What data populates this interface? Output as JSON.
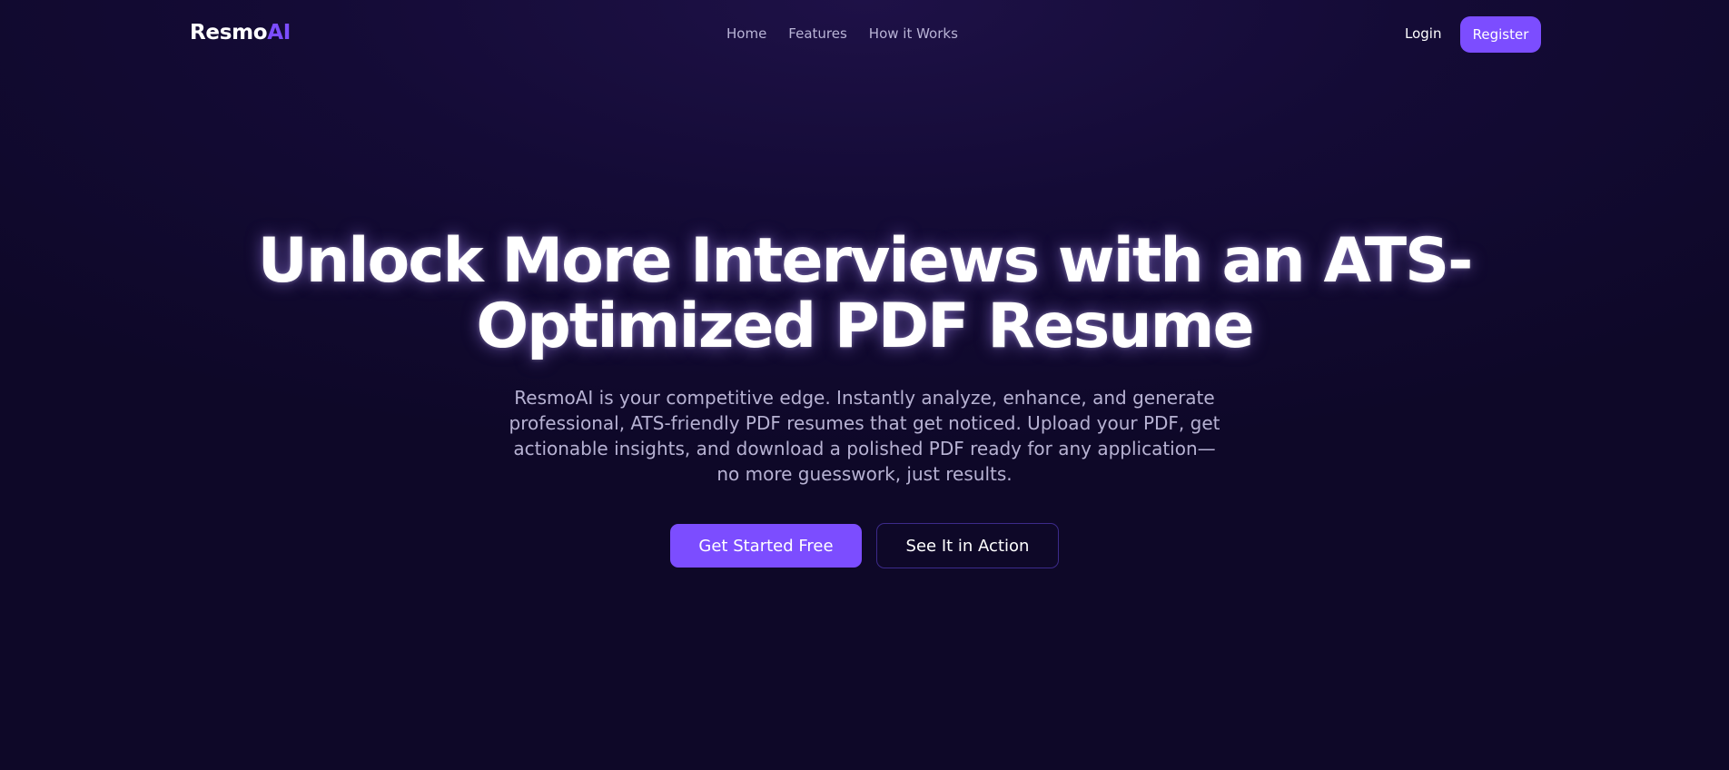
{
  "header": {
    "logo_main": "Resmo",
    "logo_accent": "AI",
    "nav": [
      {
        "label": "Home"
      },
      {
        "label": "Features"
      },
      {
        "label": "How it Works"
      }
    ],
    "login_label": "Login",
    "register_label": "Register"
  },
  "hero": {
    "title_line1": "Unlock More Interviews with an ATS-",
    "title_line2": "Optimized PDF Resume",
    "subtitle": "ResmoAI is your competitive edge. Instantly analyze, enhance, and generate professional, ATS-friendly PDF resumes that get noticed. Upload your PDF, get actionable insights, and download a polished PDF ready for any application—no more guesswork, just results.",
    "primary_cta": "Get Started Free",
    "secondary_cta": "See It in Action"
  },
  "colors": {
    "accent": "#7c4dff",
    "background": "#140b36"
  }
}
